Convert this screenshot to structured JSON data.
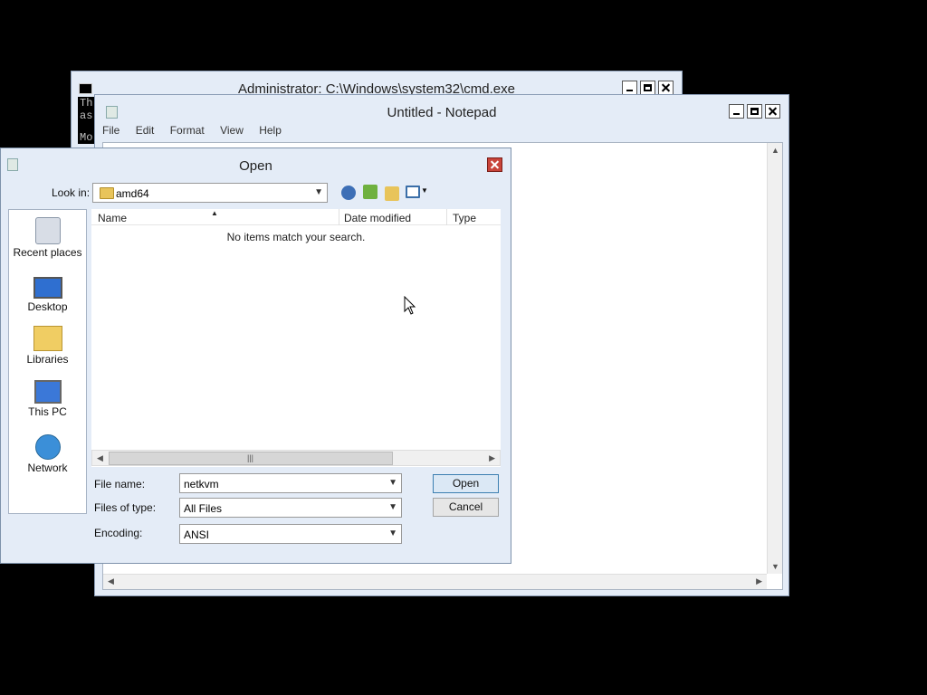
{
  "cmd": {
    "title": "Administrator: C:\\Windows\\system32\\cmd.exe",
    "text_lines": [
      "Th",
      "as",
      "",
      "Mo"
    ]
  },
  "notepad": {
    "title": "Untitled - Notepad",
    "menu": [
      "File",
      "Edit",
      "Format",
      "View",
      "Help"
    ]
  },
  "dialog": {
    "title": "Open",
    "look_in_label": "Look in:",
    "look_in_value": "amd64",
    "places": [
      {
        "label": "Recent places",
        "icon": "recent-places-icon"
      },
      {
        "label": "Desktop",
        "icon": "desktop-icon"
      },
      {
        "label": "Libraries",
        "icon": "libraries-icon"
      },
      {
        "label": "This PC",
        "icon": "this-pc-icon"
      },
      {
        "label": "Network",
        "icon": "network-icon"
      }
    ],
    "columns": [
      "Name",
      "Date modified",
      "Type"
    ],
    "empty_message": "No items match your search.",
    "file_name_label": "File name:",
    "file_name_value": "netkvm",
    "files_of_type_label": "Files of type:",
    "files_of_type_value": "All Files",
    "encoding_label": "Encoding:",
    "encoding_value": "ANSI",
    "open_button": "Open",
    "cancel_button": "Cancel"
  },
  "colors": {
    "desktop": "#000000",
    "frame": "#e4ecf7",
    "close_red": "#c8443a"
  }
}
